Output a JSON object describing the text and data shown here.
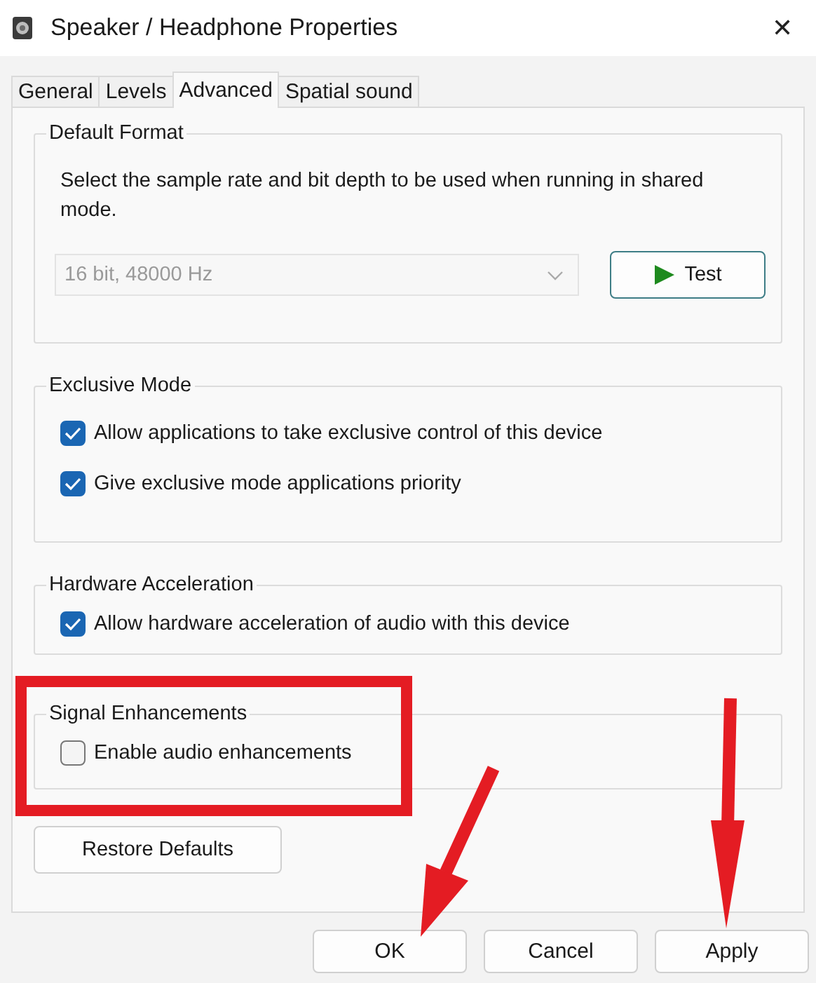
{
  "window": {
    "title": "Speaker / Headphone Properties",
    "close": "✕"
  },
  "tabs": [
    {
      "label": "General",
      "selected": false
    },
    {
      "label": "Levels",
      "selected": false
    },
    {
      "label": "Advanced",
      "selected": true
    },
    {
      "label": "Spatial sound",
      "selected": false
    }
  ],
  "default_format": {
    "title": "Default Format",
    "description": "Select the sample rate and bit depth to be used when running in shared mode.",
    "format": {
      "value": "16 bit, 48000 Hz",
      "disabled": true
    },
    "test_button": "Test"
  },
  "groups": [
    {
      "title": "Exclusive Mode",
      "options": [
        {
          "label": "Allow applications to take exclusive control of this device",
          "checked": true
        },
        {
          "label": "Give exclusive mode applications priority",
          "checked": true
        }
      ]
    },
    {
      "title": "Hardware Acceleration",
      "options": [
        {
          "label": "Allow hardware acceleration of audio with this device",
          "checked": true
        }
      ]
    },
    {
      "title": "Signal Enhancements",
      "options": [
        {
          "label": "Enable audio enhancements",
          "checked": false
        }
      ]
    }
  ],
  "restore_button": "Restore Defaults",
  "buttons": [
    "OK",
    "Cancel",
    "Apply"
  ]
}
